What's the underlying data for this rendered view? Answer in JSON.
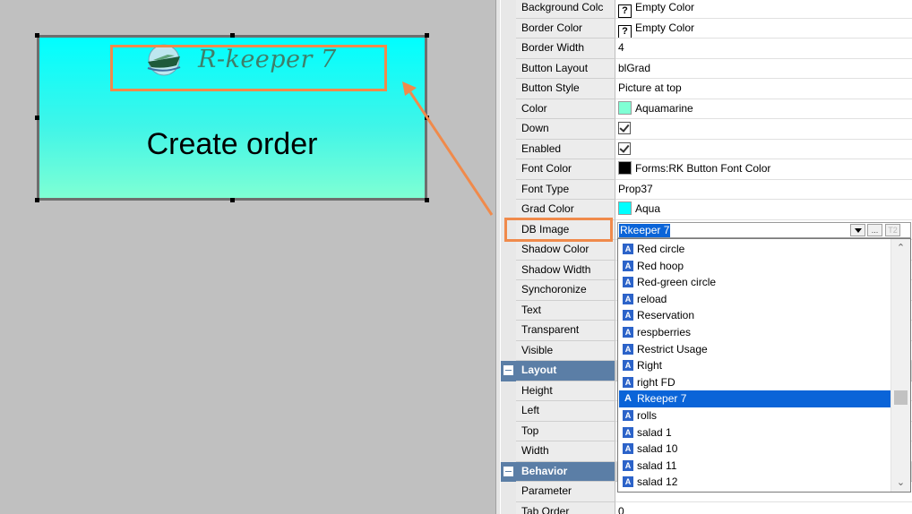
{
  "button": {
    "caption": "Create order",
    "image_text": "R-keeper 7"
  },
  "inspector": {
    "rows": [
      {
        "name": "Background Colc",
        "value": "Empty Color",
        "kind": "unknown"
      },
      {
        "name": "Border Color",
        "value": "Empty Color",
        "kind": "unknown"
      },
      {
        "name": "Border Width",
        "value": "4",
        "kind": "text"
      },
      {
        "name": "Button Layout",
        "value": "blGrad",
        "kind": "text"
      },
      {
        "name": "Button Style",
        "value": "Picture at top",
        "kind": "text"
      },
      {
        "name": "Color",
        "value": "Aquamarine",
        "kind": "color",
        "swatch": "#7fffd4"
      },
      {
        "name": "Down",
        "value": "",
        "kind": "check"
      },
      {
        "name": "Enabled",
        "value": "",
        "kind": "check"
      },
      {
        "name": "Font Color",
        "value": "Forms:RK Button Font Color",
        "kind": "color",
        "swatch": "#000000"
      },
      {
        "name": "Font Type",
        "value": "Prop37",
        "kind": "text"
      },
      {
        "name": "Grad Color",
        "value": "Aqua",
        "kind": "color",
        "swatch": "#00ffff"
      },
      {
        "name": "DB Image",
        "value": "Rkeeper 7",
        "kind": "editor"
      },
      {
        "name": "Shadow Color",
        "value": "",
        "kind": "text"
      },
      {
        "name": "Shadow Width",
        "value": "",
        "kind": "text"
      },
      {
        "name": "Synchoronize",
        "value": "",
        "kind": "text"
      },
      {
        "name": "Text",
        "value": "",
        "kind": "text"
      },
      {
        "name": "Transparent",
        "value": "",
        "kind": "text"
      },
      {
        "name": "Visible",
        "value": "",
        "kind": "text"
      },
      {
        "name": "Layout",
        "value": "",
        "kind": "category"
      },
      {
        "name": "Height",
        "value": "",
        "kind": "text"
      },
      {
        "name": "Left",
        "value": "",
        "kind": "text"
      },
      {
        "name": "Top",
        "value": "",
        "kind": "text"
      },
      {
        "name": "Width",
        "value": "",
        "kind": "text"
      },
      {
        "name": "Behavior",
        "value": "",
        "kind": "category"
      },
      {
        "name": "Parameter",
        "value": "",
        "kind": "text"
      },
      {
        "name": "Tab Order",
        "value": "0",
        "kind": "text"
      }
    ]
  },
  "db_image": {
    "value": "Rkeeper 7",
    "ellipsis_label": "...",
    "t2_label": "T2",
    "item_icon": "A",
    "items": [
      "Red circle",
      "Red hoop",
      "Red-green circle",
      "reload",
      "Reservation",
      "respberries",
      "Restrict Usage",
      "Right",
      "right FD",
      "Rkeeper 7",
      "rolls",
      "salad 1",
      "salad 10",
      "salad 11",
      "salad 12"
    ],
    "selected": "Rkeeper 7",
    "scroll_position": 0.66
  },
  "icons": {
    "unknown": "question-mark-icon",
    "check": "checkmark-icon",
    "up": "▲",
    "down": "▼"
  },
  "colors": {
    "highlight": "#f08a4b",
    "selection": "#0a64d8",
    "category": "#5b7ea6"
  }
}
